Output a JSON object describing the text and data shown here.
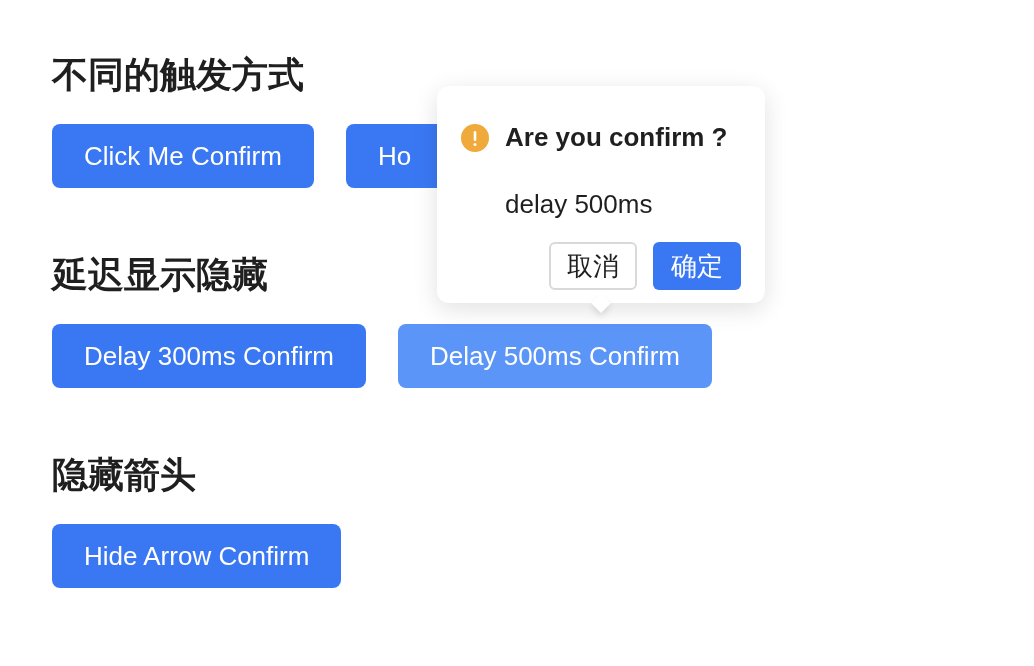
{
  "sections": [
    {
      "heading": "不同的触发方式",
      "buttons": [
        {
          "label": "Click Me Confirm",
          "hovered": false
        },
        {
          "label": "Ho",
          "hovered": false
        }
      ]
    },
    {
      "heading": "延迟显示隐藏",
      "buttons": [
        {
          "label": "Delay 300ms Confirm",
          "hovered": false
        },
        {
          "label": "Delay 500ms Confirm",
          "hovered": true
        }
      ]
    },
    {
      "heading": "隐藏箭头",
      "buttons": [
        {
          "label": "Hide Arrow Confirm",
          "hovered": false
        }
      ]
    }
  ],
  "popover": {
    "title": "Are you confirm ?",
    "description": "delay 500ms",
    "cancel": "取消",
    "confirm": "确定"
  }
}
